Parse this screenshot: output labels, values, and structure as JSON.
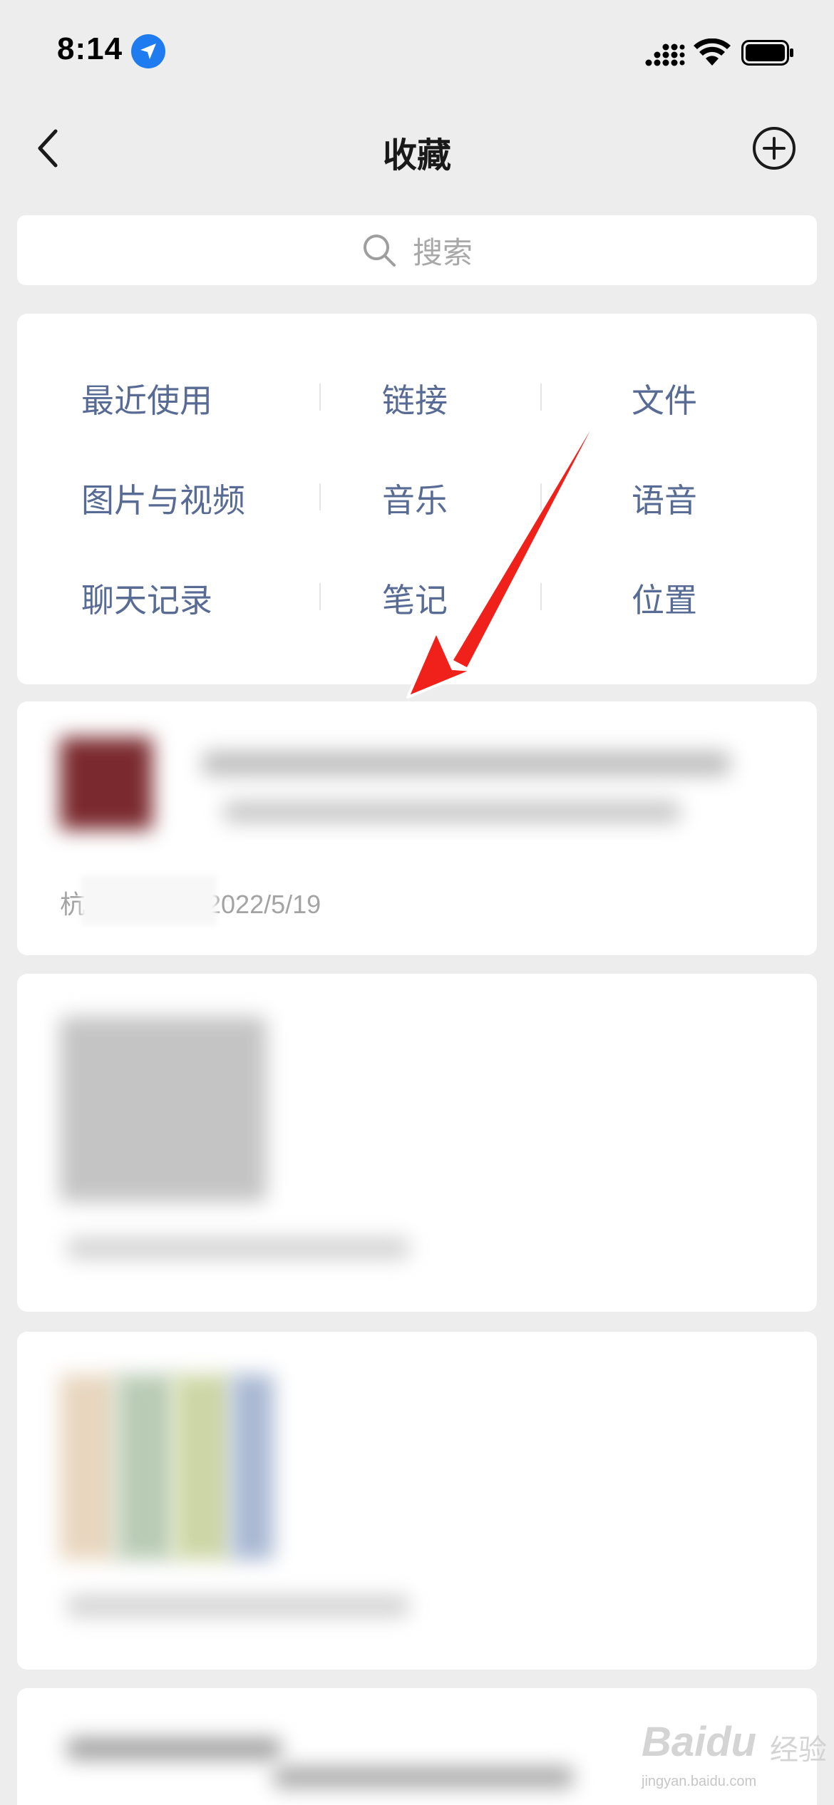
{
  "status_bar": {
    "time": "8:14"
  },
  "nav": {
    "title": "收藏"
  },
  "search": {
    "placeholder": "搜索"
  },
  "categories": {
    "rows": [
      [
        "最近使用",
        "链接",
        "文件"
      ],
      [
        "图片与视频",
        "音乐",
        "语音"
      ],
      [
        "聊天记录",
        "笔记",
        "位置"
      ]
    ]
  },
  "favorites": {
    "item1": {
      "source_prefix": "杭",
      "date": "2022/5/19"
    }
  },
  "colors": {
    "link_blue": "#576b95",
    "background": "#ededed",
    "arrow_red": "#f0201a",
    "location_blue": "#1e7cf0"
  },
  "watermark": {
    "brand": "Baidu",
    "text": "经验",
    "url": "jingyan.baidu.com"
  }
}
